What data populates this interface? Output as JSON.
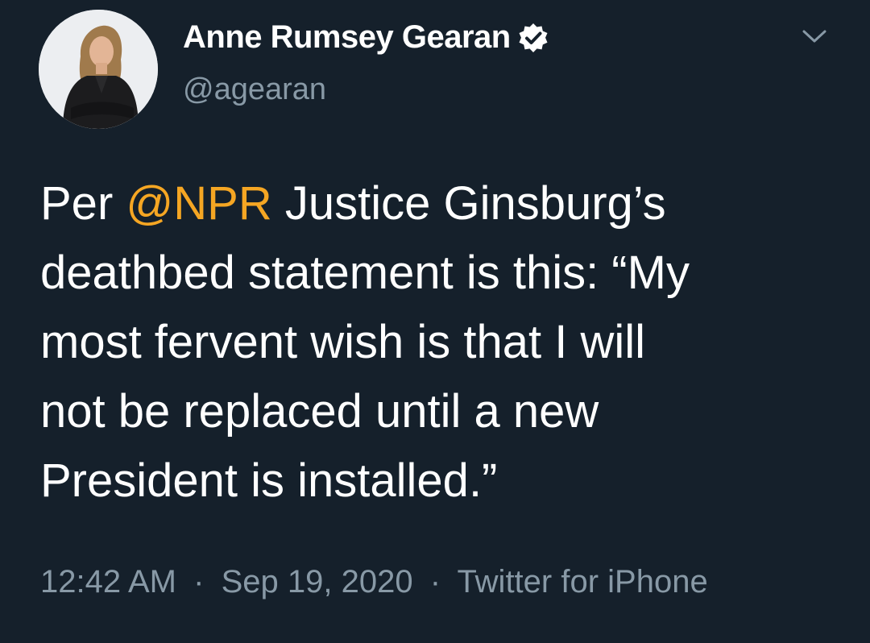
{
  "author": {
    "display_name": "Anne Rumsey Gearan",
    "handle": "@agearan",
    "verified": true,
    "avatar_icon": "profile-photo"
  },
  "menu": {
    "icon": "chevron-down-icon"
  },
  "tweet": {
    "lines": [
      {
        "prefix": "Per ",
        "mention": "@NPR",
        "rest": " Justice Ginsburg’s"
      },
      {
        "text": "deathbed statement is this: “My"
      },
      {
        "text": "most fervent wish is that I will"
      },
      {
        "text": "not be replaced until a new"
      },
      {
        "text": "President is installed.”"
      }
    ]
  },
  "meta": {
    "time": "12:42 AM",
    "separator": "·",
    "date": "Sep 19, 2020",
    "source": "Twitter for iPhone"
  },
  "colors": {
    "background": "#15202b",
    "mention": "#f5a623",
    "secondary_text": "#8899a6"
  }
}
